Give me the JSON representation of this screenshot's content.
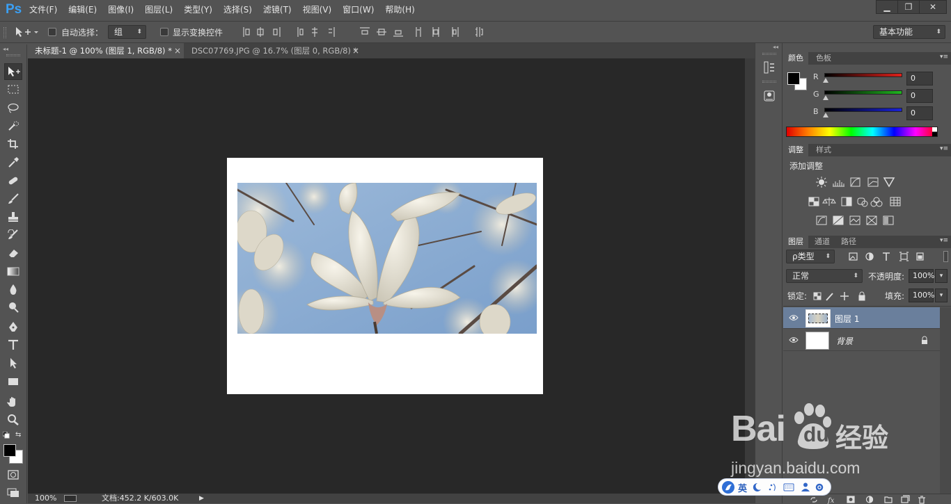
{
  "app": {
    "logo": "Ps"
  },
  "menu": [
    "文件(F)",
    "编辑(E)",
    "图像(I)",
    "图层(L)",
    "类型(Y)",
    "选择(S)",
    "滤镜(T)",
    "视图(V)",
    "窗口(W)",
    "帮助(H)"
  ],
  "window_controls": {
    "minimize": "▁",
    "restore": "❐",
    "close": "✕"
  },
  "options": {
    "auto_select_label": "自动选择：",
    "auto_select_value": "组",
    "show_transform_label": "显示变换控件",
    "workspace": "基本功能"
  },
  "tabs": [
    {
      "label": "未标题-1 @ 100% (图层 1, RGB/8) *",
      "active": true,
      "close": "×"
    },
    {
      "label": "DSC07769.JPG @ 16.7% (图层 0, RGB/8) *",
      "active": false,
      "close": "×"
    }
  ],
  "status": {
    "zoom": "100%",
    "doc": "文档:452.2 K/603.0K",
    "arrow": "▶"
  },
  "color_panel": {
    "tabs": [
      "颜色",
      "色板"
    ],
    "channels": [
      {
        "label": "R",
        "value": "0",
        "color": "#e0201a"
      },
      {
        "label": "G",
        "value": "0",
        "color": "#1fb51f"
      },
      {
        "label": "B",
        "value": "0",
        "color": "#1a22d8"
      }
    ]
  },
  "adjust_panel": {
    "tabs": [
      "调整",
      "样式"
    ],
    "title": "添加调整"
  },
  "layers_panel": {
    "tabs": [
      "图层",
      "通道",
      "路径"
    ],
    "filter": "ρ类型",
    "blend_mode": "正常",
    "opacity_label": "不透明度:",
    "opacity_value": "100%",
    "lock_label": "锁定:",
    "fill_label": "填充:",
    "fill_value": "100%",
    "layers": [
      {
        "name": "图层 1",
        "selected": true
      },
      {
        "name": "背景",
        "selected": false
      }
    ]
  },
  "watermark": {
    "brand_a": "Bai",
    "brand_b": "du",
    "suffix": "经验",
    "url": "jingyan.baidu.com"
  },
  "ime": {
    "label": "英"
  },
  "colors": {
    "accent": "#3ba0f5",
    "selected_layer": "#6a7f9c",
    "canvas_bg": "#282828"
  }
}
